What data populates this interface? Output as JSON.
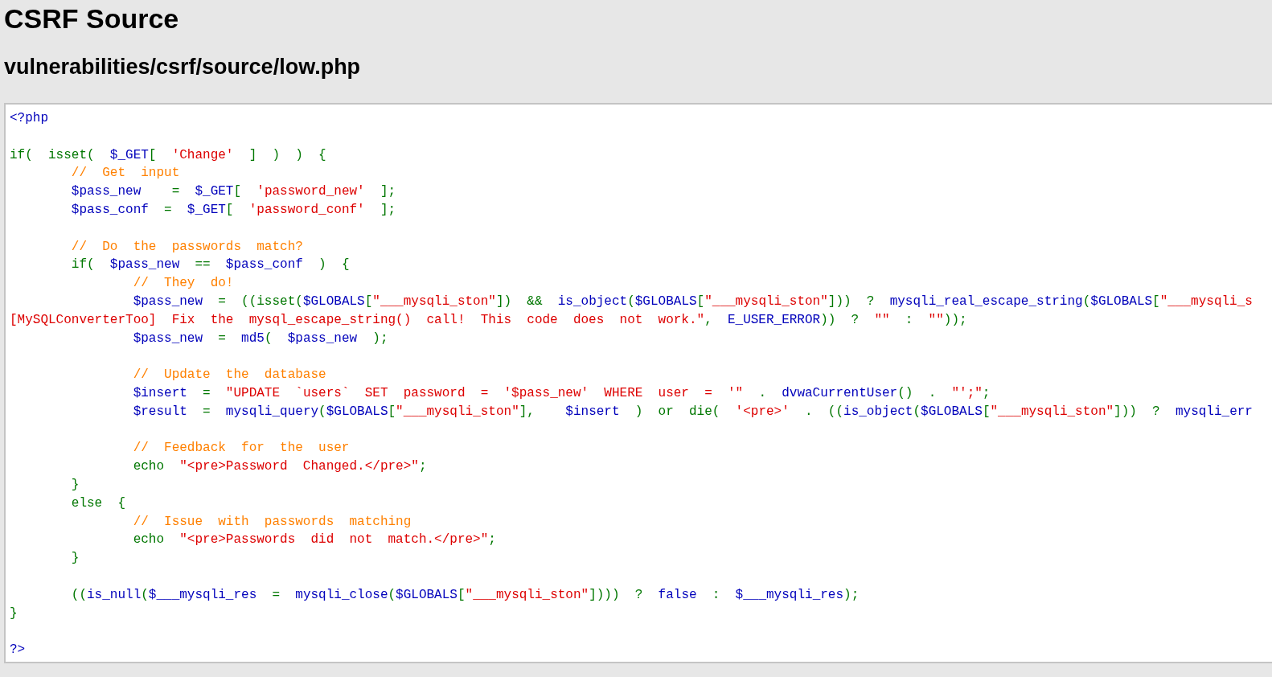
{
  "title": "CSRF Source",
  "file_path": "vulnerabilities/csrf/source/low.php",
  "code": {
    "lines": [
      {
        "kind": "code",
        "tokens": [
          {
            "kind": "default",
            "text": "<?php"
          }
        ]
      },
      {
        "kind": "blank"
      },
      {
        "kind": "code",
        "tokens": [
          {
            "kind": "keyword",
            "text": "if(  isset(  "
          },
          {
            "kind": "default",
            "text": "$_GET"
          },
          {
            "kind": "keyword",
            "text": "[  "
          },
          {
            "kind": "string",
            "text": "'Change'"
          },
          {
            "kind": "keyword",
            "text": "  ]  )  )  {"
          }
        ]
      },
      {
        "kind": "code",
        "tokens": [
          {
            "kind": "comment",
            "text": "\t//  Get  input"
          }
        ]
      },
      {
        "kind": "code",
        "tokens": [
          {
            "kind": "default",
            "text": "\t$pass_new"
          },
          {
            "kind": "keyword",
            "text": "    =  "
          },
          {
            "kind": "default",
            "text": "$_GET"
          },
          {
            "kind": "keyword",
            "text": "[  "
          },
          {
            "kind": "string",
            "text": "'password_new'"
          },
          {
            "kind": "keyword",
            "text": "  ];"
          }
        ]
      },
      {
        "kind": "code",
        "tokens": [
          {
            "kind": "default",
            "text": "\t$pass_conf"
          },
          {
            "kind": "keyword",
            "text": "  =  "
          },
          {
            "kind": "default",
            "text": "$_GET"
          },
          {
            "kind": "keyword",
            "text": "[  "
          },
          {
            "kind": "string",
            "text": "'password_conf'"
          },
          {
            "kind": "keyword",
            "text": "  ];"
          }
        ]
      },
      {
        "kind": "blank"
      },
      {
        "kind": "code",
        "tokens": [
          {
            "kind": "comment",
            "text": "\t//  Do  the  passwords  match?"
          }
        ]
      },
      {
        "kind": "code",
        "tokens": [
          {
            "kind": "keyword",
            "text": "\tif(  "
          },
          {
            "kind": "default",
            "text": "$pass_new"
          },
          {
            "kind": "keyword",
            "text": "  ==  "
          },
          {
            "kind": "default",
            "text": "$pass_conf"
          },
          {
            "kind": "keyword",
            "text": "  )  {"
          }
        ]
      },
      {
        "kind": "code",
        "tokens": [
          {
            "kind": "comment",
            "text": "\t\t//  They  do!"
          }
        ]
      },
      {
        "kind": "code",
        "tokens": [
          {
            "kind": "default",
            "text": "\t\t$pass_new"
          },
          {
            "kind": "keyword",
            "text": "  =  ((isset("
          },
          {
            "kind": "default",
            "text": "$GLOBALS"
          },
          {
            "kind": "keyword",
            "text": "["
          },
          {
            "kind": "string",
            "text": "\"___mysqli_ston\""
          },
          {
            "kind": "keyword",
            "text": "])  &&  "
          },
          {
            "kind": "default",
            "text": "is_object"
          },
          {
            "kind": "keyword",
            "text": "("
          },
          {
            "kind": "default",
            "text": "$GLOBALS"
          },
          {
            "kind": "keyword",
            "text": "["
          },
          {
            "kind": "string",
            "text": "\"___mysqli_ston\""
          },
          {
            "kind": "keyword",
            "text": "]))  ?  "
          },
          {
            "kind": "default",
            "text": "mysqli_real_escape_string"
          },
          {
            "kind": "keyword",
            "text": "("
          },
          {
            "kind": "default",
            "text": "$GLOBALS"
          },
          {
            "kind": "keyword",
            "text": "["
          },
          {
            "kind": "string",
            "text": "\"___mysqli_s"
          }
        ]
      },
      {
        "kind": "code",
        "tokens": [
          {
            "kind": "string",
            "text": "[MySQLConverterToo]  Fix  the  mysql_escape_string()  call!  This  code  does  not  work.\""
          },
          {
            "kind": "keyword",
            "text": ",  "
          },
          {
            "kind": "default",
            "text": "E_USER_ERROR"
          },
          {
            "kind": "keyword",
            "text": "))  ?  "
          },
          {
            "kind": "string",
            "text": "\"\""
          },
          {
            "kind": "keyword",
            "text": "  :  "
          },
          {
            "kind": "string",
            "text": "\"\""
          },
          {
            "kind": "keyword",
            "text": "));"
          }
        ]
      },
      {
        "kind": "code",
        "tokens": [
          {
            "kind": "default",
            "text": "\t\t$pass_new"
          },
          {
            "kind": "keyword",
            "text": "  =  "
          },
          {
            "kind": "default",
            "text": "md5"
          },
          {
            "kind": "keyword",
            "text": "(  "
          },
          {
            "kind": "default",
            "text": "$pass_new"
          },
          {
            "kind": "keyword",
            "text": "  );"
          }
        ]
      },
      {
        "kind": "blank"
      },
      {
        "kind": "code",
        "tokens": [
          {
            "kind": "comment",
            "text": "\t\t//  Update  the  database"
          }
        ]
      },
      {
        "kind": "code",
        "tokens": [
          {
            "kind": "default",
            "text": "\t\t$insert"
          },
          {
            "kind": "keyword",
            "text": "  =  "
          },
          {
            "kind": "string",
            "text": "\"UPDATE  `users`  SET  password  =  '$pass_new'  WHERE  user  =  '\""
          },
          {
            "kind": "keyword",
            "text": "  .  "
          },
          {
            "kind": "default",
            "text": "dvwaCurrentUser"
          },
          {
            "kind": "keyword",
            "text": "()  .  "
          },
          {
            "kind": "string",
            "text": "\"';\""
          },
          {
            "kind": "keyword",
            "text": ";"
          }
        ]
      },
      {
        "kind": "code",
        "tokens": [
          {
            "kind": "default",
            "text": "\t\t$result"
          },
          {
            "kind": "keyword",
            "text": "  =  "
          },
          {
            "kind": "default",
            "text": "mysqli_query"
          },
          {
            "kind": "keyword",
            "text": "("
          },
          {
            "kind": "default",
            "text": "$GLOBALS"
          },
          {
            "kind": "keyword",
            "text": "["
          },
          {
            "kind": "string",
            "text": "\"___mysqli_ston\""
          },
          {
            "kind": "keyword",
            "text": "],    "
          },
          {
            "kind": "default",
            "text": "$insert"
          },
          {
            "kind": "keyword",
            "text": "  )  or  die(  "
          },
          {
            "kind": "string",
            "text": "'<pre>'"
          },
          {
            "kind": "keyword",
            "text": "  .  (("
          },
          {
            "kind": "default",
            "text": "is_object"
          },
          {
            "kind": "keyword",
            "text": "("
          },
          {
            "kind": "default",
            "text": "$GLOBALS"
          },
          {
            "kind": "keyword",
            "text": "["
          },
          {
            "kind": "string",
            "text": "\"___mysqli_ston\""
          },
          {
            "kind": "keyword",
            "text": "]))  ?  "
          },
          {
            "kind": "default",
            "text": "mysqli_err"
          }
        ]
      },
      {
        "kind": "blank"
      },
      {
        "kind": "code",
        "tokens": [
          {
            "kind": "comment",
            "text": "\t\t//  Feedback  for  the  user"
          }
        ]
      },
      {
        "kind": "code",
        "tokens": [
          {
            "kind": "keyword",
            "text": "\t\techo  "
          },
          {
            "kind": "string",
            "text": "\"<pre>Password  Changed.</pre>\""
          },
          {
            "kind": "keyword",
            "text": ";"
          }
        ]
      },
      {
        "kind": "code",
        "tokens": [
          {
            "kind": "keyword",
            "text": "\t}"
          }
        ]
      },
      {
        "kind": "code",
        "tokens": [
          {
            "kind": "keyword",
            "text": "\telse  {"
          }
        ]
      },
      {
        "kind": "code",
        "tokens": [
          {
            "kind": "comment",
            "text": "\t\t//  Issue  with  passwords  matching"
          }
        ]
      },
      {
        "kind": "code",
        "tokens": [
          {
            "kind": "keyword",
            "text": "\t\techo  "
          },
          {
            "kind": "string",
            "text": "\"<pre>Passwords  did  not  match.</pre>\""
          },
          {
            "kind": "keyword",
            "text": ";"
          }
        ]
      },
      {
        "kind": "code",
        "tokens": [
          {
            "kind": "keyword",
            "text": "\t}"
          }
        ]
      },
      {
        "kind": "blank"
      },
      {
        "kind": "code",
        "tokens": [
          {
            "kind": "keyword",
            "text": "\t(("
          },
          {
            "kind": "default",
            "text": "is_null"
          },
          {
            "kind": "keyword",
            "text": "("
          },
          {
            "kind": "default",
            "text": "$___mysqli_res"
          },
          {
            "kind": "keyword",
            "text": "  =  "
          },
          {
            "kind": "default",
            "text": "mysqli_close"
          },
          {
            "kind": "keyword",
            "text": "("
          },
          {
            "kind": "default",
            "text": "$GLOBALS"
          },
          {
            "kind": "keyword",
            "text": "["
          },
          {
            "kind": "string",
            "text": "\"___mysqli_ston\""
          },
          {
            "kind": "keyword",
            "text": "])))  ?  "
          },
          {
            "kind": "default",
            "text": "false"
          },
          {
            "kind": "keyword",
            "text": "  :  "
          },
          {
            "kind": "default",
            "text": "$___mysqli_res"
          },
          {
            "kind": "keyword",
            "text": ");"
          }
        ]
      },
      {
        "kind": "code",
        "tokens": [
          {
            "kind": "keyword",
            "text": "}"
          }
        ]
      },
      {
        "kind": "blank"
      },
      {
        "kind": "code",
        "tokens": [
          {
            "kind": "default",
            "text": "?>"
          }
        ]
      }
    ]
  }
}
